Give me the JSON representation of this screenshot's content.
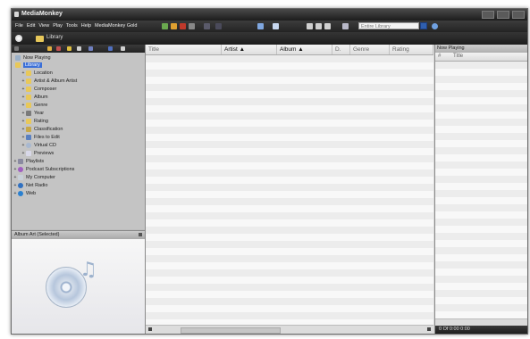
{
  "window": {
    "title": "MediaMonkey"
  },
  "menu": [
    "File",
    "Edit",
    "View",
    "Play",
    "Tools",
    "Help",
    "MediaMonkey Gold"
  ],
  "search": {
    "placeholder": "Entire Library"
  },
  "breadcrumb": {
    "label": "Library"
  },
  "tree": {
    "now_playing": "Now Playing",
    "library": "Library",
    "library_children": [
      "Location",
      "Artist & Album Artist",
      "Composer",
      "Album",
      "Genre",
      "Year",
      "Rating",
      "Classification",
      "Files to Edit",
      "Virtual CD",
      "Previews"
    ],
    "root_items": [
      "Playlists",
      "Podcast Subscriptions",
      "My Computer",
      "Net Radio",
      "Web"
    ]
  },
  "album_art": {
    "title": "Album Art (Selected)"
  },
  "columns": [
    {
      "label": "Title",
      "active": false
    },
    {
      "label": "Artist ▲",
      "active": true
    },
    {
      "label": "Album ▲",
      "active": true
    },
    {
      "label": "D.",
      "active": false
    },
    {
      "label": "Genre",
      "active": false
    },
    {
      "label": "Rating",
      "active": false
    }
  ],
  "now_playing_panel": {
    "title": "Now Playing",
    "col_num": "#",
    "col_title": "Title",
    "footer": "0 Of 0:00 0:00"
  },
  "colors": {
    "selection": "#3a6fd8",
    "title_bar": "#1c1c1c",
    "folder": "#e8c85a"
  }
}
